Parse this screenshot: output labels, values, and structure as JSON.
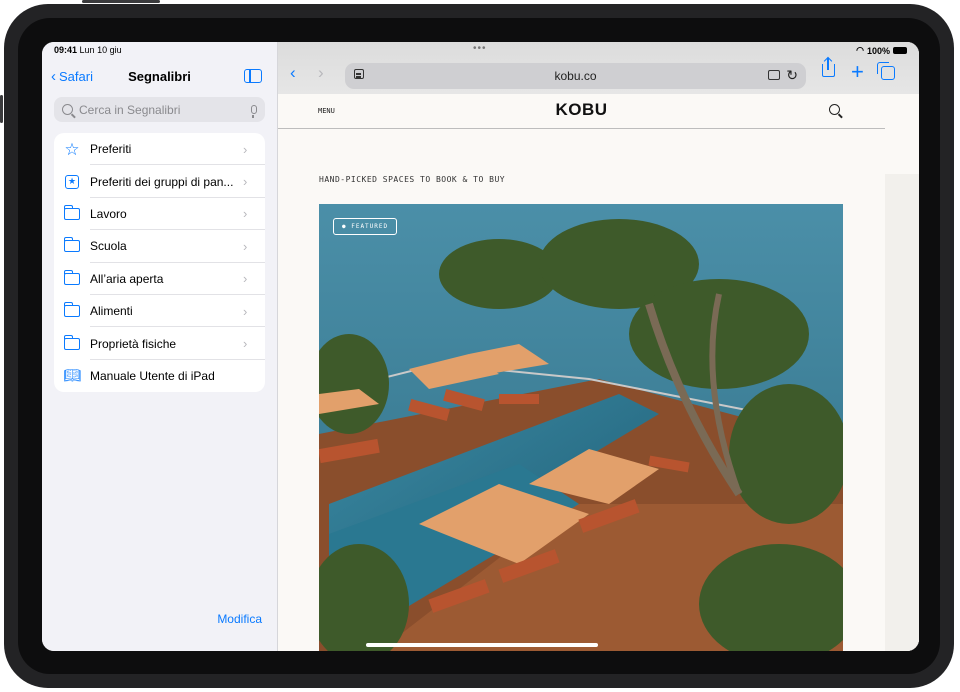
{
  "status": {
    "time": "09:41",
    "date": "Lun 10 giu",
    "battery": "100%"
  },
  "sidebar": {
    "back_label": "Safari",
    "title": "Segnalibri",
    "search_placeholder": "Cerca in Segnalibri",
    "items": [
      {
        "label": "Preferiti",
        "icon": "star-icon",
        "chevron": true
      },
      {
        "label": "Preferiti dei gruppi di pan...",
        "icon": "star-box-icon",
        "chevron": true
      },
      {
        "label": "Lavoro",
        "icon": "folder-icon",
        "chevron": true
      },
      {
        "label": "Scuola",
        "icon": "folder-icon",
        "chevron": true
      },
      {
        "label": "All’aria aperta",
        "icon": "folder-icon",
        "chevron": true
      },
      {
        "label": "Alimenti",
        "icon": "folder-icon",
        "chevron": true
      },
      {
        "label": "Proprietà fisiche",
        "icon": "folder-icon",
        "chevron": true
      },
      {
        "label": "Manuale Utente di iPad",
        "icon": "book-icon",
        "chevron": false
      }
    ],
    "edit_label": "Modifica"
  },
  "browser": {
    "url": "kobu.co",
    "colors": {
      "accent": "#0a7aff"
    }
  },
  "site": {
    "menu_label": "MENU",
    "logo": "KOBU",
    "tagline": "HAND-PICKED SPACES TO BOOK & TO BUY",
    "featured_badge": "● FEATURED"
  }
}
